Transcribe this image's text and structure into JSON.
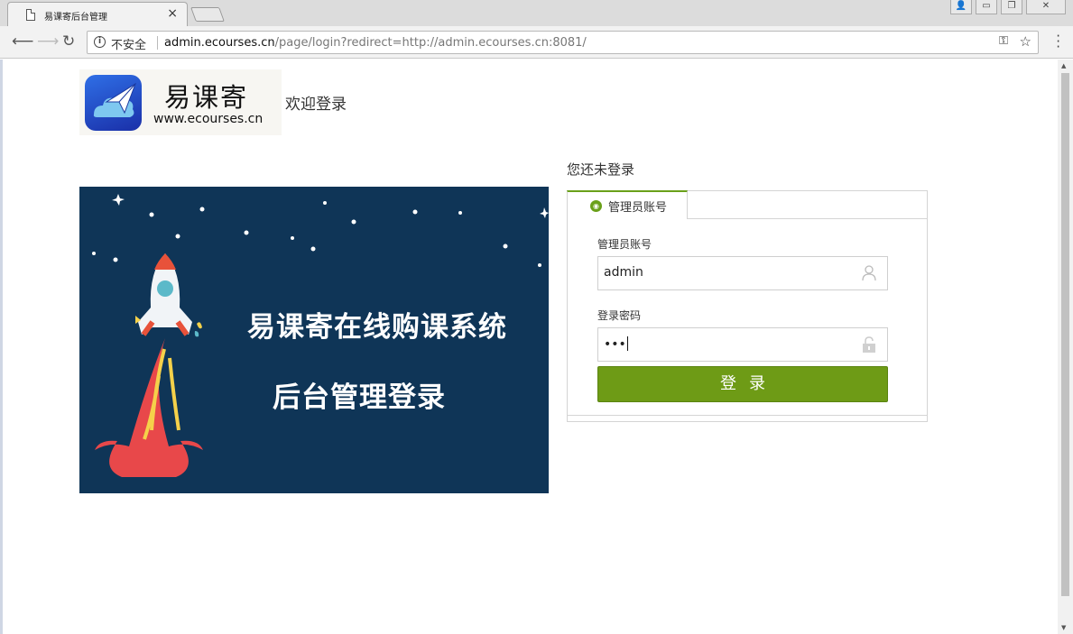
{
  "browser": {
    "tab_title": "易课寄后台管理",
    "tab_close": "×",
    "security_label": "不安全",
    "url_host": "admin.ecourses.cn",
    "url_path": "/page/login?redirect=http://admin.ecourses.cn:8081/",
    "window_buttons": [
      "👤",
      "▭",
      "❐",
      "✕"
    ]
  },
  "header": {
    "brand_name": "易课寄",
    "brand_url": "www.ecourses.cn",
    "welcome": "欢迎登录"
  },
  "banner": {
    "headline": "易课寄在线购课系统",
    "subline": "后台管理登录"
  },
  "login": {
    "status": "您还未登录",
    "tab_label": "管理员账号",
    "username_label": "管理员账号",
    "username_value": "admin",
    "password_label": "登录密码",
    "password_value": "•••",
    "submit_label": "登录"
  },
  "colors": {
    "accent": "#6e9b16",
    "banner_bg": "#0f3557"
  }
}
